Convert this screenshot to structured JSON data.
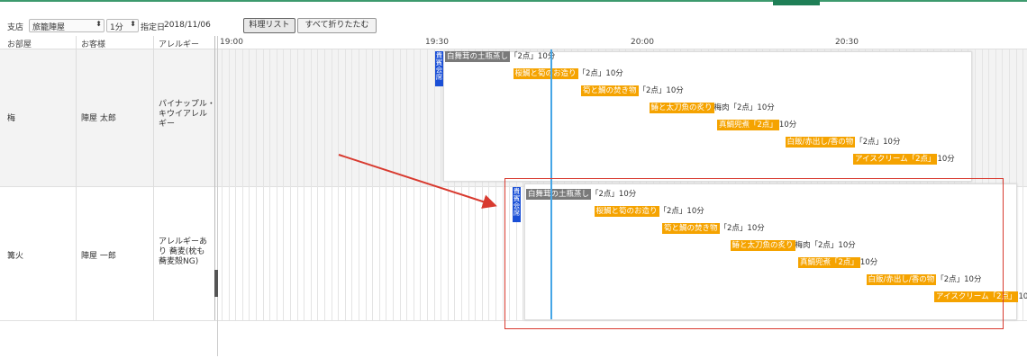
{
  "toolbar": {
    "store_label": "支店",
    "store_value": "旅籠陣屋",
    "interval_value": "1分",
    "date_label": "指定日",
    "date_value": "2018/11/06",
    "cuisine_list_button": "料理リスト",
    "collapse_all_button": "すべて折りたたむ"
  },
  "columns": {
    "room": "お部屋",
    "guest": "お客様",
    "allergy": "アレルギー",
    "times": [
      "19:00",
      "19:30",
      "20:00",
      "20:30"
    ]
  },
  "rows": [
    {
      "room": "梅",
      "guest": "陣屋 太郎",
      "allergy": "パイナップル・\nキウイアレル\nギー",
      "badge": "貴賓会席",
      "courses": [
        {
          "dish": "白舞茸の土瓶蒸し",
          "note": "「2点」10分"
        },
        {
          "dish": "桜鯛と筍のお造り",
          "note": "「2点」10分"
        },
        {
          "dish": "筍と鯛の焚き物",
          "note": "「2点」10分"
        },
        {
          "dish": "鰆と太刀魚の炙り",
          "note": "梅肉「2点」10分"
        },
        {
          "dish": "真鯛兜煮「2点」",
          "note": "10分"
        },
        {
          "dish": "白飯/赤出し/香の物",
          "note": "「2点」10分"
        },
        {
          "dish": "アイスクリーム「2点」",
          "note": "10分"
        }
      ]
    },
    {
      "room": "篝火",
      "guest": "陣屋 一郎",
      "allergy": "アレルギーあ\nり 蕎麦(枕も\n蕎麦殻NG)",
      "badge": "貴賓会席",
      "courses": [
        {
          "dish": "白舞茸の土瓶蒸し",
          "note": "「2点」10分"
        },
        {
          "dish": "桜鯛と筍のお造り",
          "note": "「2点」10分"
        },
        {
          "dish": "筍と鯛の焚き物",
          "note": "「2点」10分"
        },
        {
          "dish": "鰆と太刀魚の炙り",
          "note": "梅肉「2点」10分"
        },
        {
          "dish": "真鯛兜煮「2点」",
          "note": "10分"
        },
        {
          "dish": "白飯/赤出し/香の物",
          "note": "「2点」10分"
        },
        {
          "dish": "アイスクリーム「2点」",
          "note": "10"
        }
      ]
    }
  ],
  "colors": {
    "course_bar": "#f5a300",
    "first_course_bar": "#7a7a7a",
    "badge": "#1a4fd6",
    "now_line": "#46a6e6",
    "highlight_box": "#d83a2f",
    "arrow": "#d83a2f"
  }
}
